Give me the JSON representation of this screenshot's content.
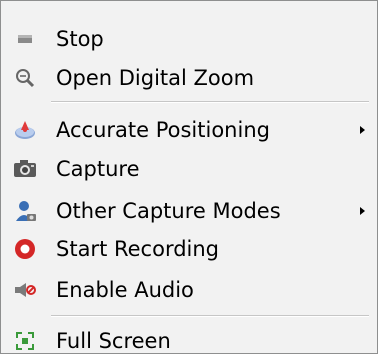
{
  "menu": {
    "items": [
      {
        "label": "Stop",
        "icon": "stop-icon",
        "submenu": false
      },
      {
        "label": "Open Digital Zoom",
        "icon": "zoom-icon",
        "submenu": false
      },
      {
        "label": "Accurate Positioning",
        "icon": "positioning-icon",
        "submenu": true
      },
      {
        "label": "Capture",
        "icon": "camera-icon",
        "submenu": false
      },
      {
        "label": "Other Capture Modes",
        "icon": "user-capture-icon",
        "submenu": true
      },
      {
        "label": "Start Recording",
        "icon": "record-icon",
        "submenu": false
      },
      {
        "label": "Enable Audio",
        "icon": "audio-icon",
        "submenu": false
      },
      {
        "label": "Full Screen",
        "icon": "fullscreen-icon",
        "submenu": false
      }
    ]
  },
  "colors": {
    "menu_background": "#f2f2f2",
    "border": "#8e8f8f",
    "record_red": "#d42727"
  }
}
